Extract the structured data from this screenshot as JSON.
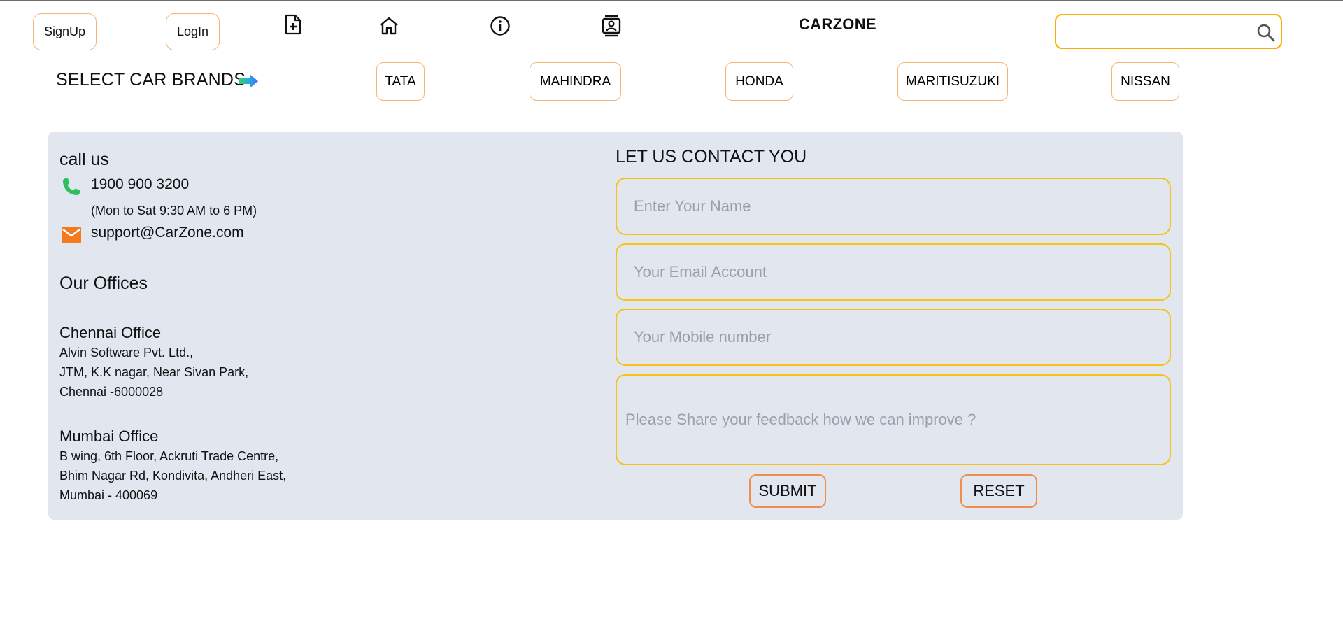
{
  "header": {
    "signup_label": "SignUp",
    "login_label": "LogIn",
    "nav_icons": [
      "add-document-icon",
      "home-icon",
      "info-icon",
      "contacts-icon"
    ],
    "brand": "CARZONE",
    "search": {
      "value": "",
      "placeholder": ""
    }
  },
  "brands_row": {
    "label": "SELECT CAR BRANDS",
    "brands": [
      "TATA",
      "MAHINDRA",
      "HONDA",
      "MARITISUZUKI",
      "NISSAN"
    ]
  },
  "contact_info": {
    "call_us_title": "call us",
    "phone": "1900 900 3200",
    "hours": "(Mon to Sat 9:30 AM to 6 PM)",
    "email": "support@CarZone.com",
    "offices_title": "Our Offices",
    "offices": [
      {
        "name": "Chennai Office",
        "lines": [
          "Alvin Software Pvt. Ltd.,",
          "JTM, K.K nagar, Near Sivan Park,",
          "Chennai -6000028"
        ]
      },
      {
        "name": "Mumbai Office",
        "lines": [
          "B wing, 6th Floor, Ackruti Trade Centre,",
          "Bhim Nagar Rd, Kondivita, Andheri East,",
          "Mumbai - 400069"
        ]
      }
    ]
  },
  "contact_form": {
    "title": "LET US CONTACT YOU",
    "name_placeholder": "Enter Your Name",
    "email_placeholder": "Your Email Account",
    "mobile_placeholder": "Your Mobile number",
    "feedback_placeholder": "Please Share your feedback how we can improve ?",
    "submit_label": "SUBMIT",
    "reset_label": "RESET"
  },
  "colors": {
    "button_border": "#f5b37a",
    "field_border": "#f5c215",
    "panel_bg": "#e2e7ef",
    "phone_icon": "#2fbf5f",
    "mail_icon": "#f47a1f"
  }
}
